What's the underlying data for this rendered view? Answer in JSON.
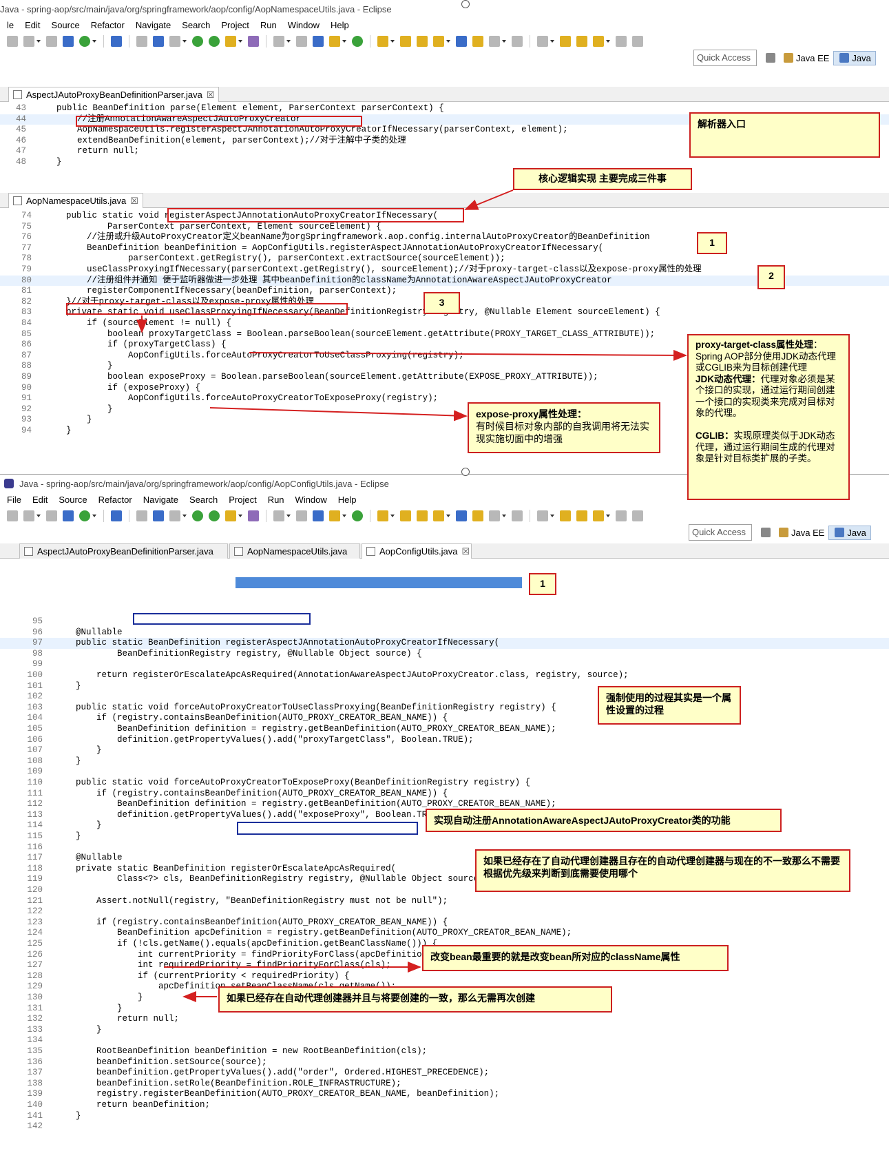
{
  "window_top": {
    "title": "Java - spring-aop/src/main/java/org/springframework/aop/config/AopNamespaceUtils.java - Eclipse",
    "menu": [
      "le",
      "Edit",
      "Source",
      "Refactor",
      "Navigate",
      "Search",
      "Project",
      "Run",
      "Window",
      "Help"
    ],
    "quick_access": "Quick Access",
    "perspectives": [
      "Java EE",
      "Java"
    ],
    "editor1": {
      "tab": "AspectJAutoProxyBeanDefinitionParser.java",
      "lines": [
        {
          "n": "43",
          "t": "    public BeanDefinition parse(Element element, ParserContext parserContext) {"
        },
        {
          "n": "44",
          "t": "        //注册AnnotationAwareAspectJAutoProxyCreator"
        },
        {
          "n": "45",
          "t": "        AopNamespaceUtils.registerAspectJAnnotationAutoProxyCreatorIfNecessary(parserContext, element);"
        },
        {
          "n": "46",
          "t": "        extendBeanDefinition(element, parserContext);//对于注解中子类的处理"
        },
        {
          "n": "47",
          "t": "        return null;"
        },
        {
          "n": "48",
          "t": "    }"
        }
      ]
    },
    "editor2": {
      "tab": "AopNamespaceUtils.java",
      "lines": [
        {
          "n": "74",
          "t": "    public static void registerAspectJAnnotationAutoProxyCreatorIfNecessary("
        },
        {
          "n": "75",
          "t": "            ParserContext parserContext, Element sourceElement) {"
        },
        {
          "n": "76",
          "t": "        //注册或升级AutoProxyCreator定义beanName为orgSpringframework.aop.config.internalAutoProxyCreator的BeanDefinition"
        },
        {
          "n": "77",
          "t": "        BeanDefinition beanDefinition = AopConfigUtils.registerAspectJAnnotationAutoProxyCreatorIfNecessary("
        },
        {
          "n": "78",
          "t": "                parserContext.getRegistry(), parserContext.extractSource(sourceElement));"
        },
        {
          "n": "79",
          "t": "        useClassProxyingIfNecessary(parserContext.getRegistry(), sourceElement);//对于proxy-target-class以及expose-proxy属性的处理"
        },
        {
          "n": "80",
          "t": "        //注册组件并通知 便于监听器做进一步处理 其中beanDefinition的className为AnnotationAwareAspectJAutoProxyCreator"
        },
        {
          "n": "81",
          "t": "        registerComponentIfNecessary(beanDefinition, parserContext);"
        },
        {
          "n": "82",
          "t": "    }//对于proxy-target-class以及expose-proxy属性的处理"
        },
        {
          "n": "83",
          "t": "    private static void useClassProxyingIfNecessary(BeanDefinitionRegistry registry, @Nullable Element sourceElement) {"
        },
        {
          "n": "84",
          "t": "        if (sourceElement != null) {"
        },
        {
          "n": "85",
          "t": "            boolean proxyTargetClass = Boolean.parseBoolean(sourceElement.getAttribute(PROXY_TARGET_CLASS_ATTRIBUTE));"
        },
        {
          "n": "86",
          "t": "            if (proxyTargetClass) {"
        },
        {
          "n": "87",
          "t": "                AopConfigUtils.forceAutoProxyCreatorToUseClassProxying(registry);"
        },
        {
          "n": "88",
          "t": "            }"
        },
        {
          "n": "89",
          "t": "            boolean exposeProxy = Boolean.parseBoolean(sourceElement.getAttribute(EXPOSE_PROXY_ATTRIBUTE));"
        },
        {
          "n": "90",
          "t": "            if (exposeProxy) {"
        },
        {
          "n": "91",
          "t": "                AopConfigUtils.forceAutoProxyCreatorToExposeProxy(registry);"
        },
        {
          "n": "92",
          "t": "            }"
        },
        {
          "n": "93",
          "t": "        }"
        },
        {
          "n": "94",
          "t": "    }"
        }
      ]
    }
  },
  "window_bottom": {
    "title": "Java - spring-aop/src/main/java/org/springframework/aop/config/AopConfigUtils.java - Eclipse",
    "menu": [
      "File",
      "Edit",
      "Source",
      "Refactor",
      "Navigate",
      "Search",
      "Project",
      "Run",
      "Window",
      "Help"
    ],
    "quick_access": "Quick Access",
    "perspectives": [
      "Java EE",
      "Java"
    ],
    "tabs": [
      "AspectJAutoProxyBeanDefinitionParser.java",
      "AopNamespaceUtils.java",
      "AopConfigUtils.java"
    ],
    "lines": [
      {
        "n": "95",
        "t": ""
      },
      {
        "n": "96",
        "t": "    @Nullable"
      },
      {
        "n": "97",
        "t": "    public static BeanDefinition registerAspectJAnnotationAutoProxyCreatorIfNecessary("
      },
      {
        "n": "98",
        "t": "            BeanDefinitionRegistry registry, @Nullable Object source) {"
      },
      {
        "n": "99",
        "t": ""
      },
      {
        "n": "100",
        "t": "        return registerOrEscalateApcAsRequired(AnnotationAwareAspectJAutoProxyCreator.class, registry, source);"
      },
      {
        "n": "101",
        "t": "    }"
      },
      {
        "n": "102",
        "t": ""
      },
      {
        "n": "103",
        "t": "    public static void forceAutoProxyCreatorToUseClassProxying(BeanDefinitionRegistry registry) {"
      },
      {
        "n": "104",
        "t": "        if (registry.containsBeanDefinition(AUTO_PROXY_CREATOR_BEAN_NAME)) {"
      },
      {
        "n": "105",
        "t": "            BeanDefinition definition = registry.getBeanDefinition(AUTO_PROXY_CREATOR_BEAN_NAME);"
      },
      {
        "n": "106",
        "t": "            definition.getPropertyValues().add(\"proxyTargetClass\", Boolean.TRUE);"
      },
      {
        "n": "107",
        "t": "        }"
      },
      {
        "n": "108",
        "t": "    }"
      },
      {
        "n": "109",
        "t": ""
      },
      {
        "n": "110",
        "t": "    public static void forceAutoProxyCreatorToExposeProxy(BeanDefinitionRegistry registry) {"
      },
      {
        "n": "111",
        "t": "        if (registry.containsBeanDefinition(AUTO_PROXY_CREATOR_BEAN_NAME)) {"
      },
      {
        "n": "112",
        "t": "            BeanDefinition definition = registry.getBeanDefinition(AUTO_PROXY_CREATOR_BEAN_NAME);"
      },
      {
        "n": "113",
        "t": "            definition.getPropertyValues().add(\"exposeProxy\", Boolean.TRUE);"
      },
      {
        "n": "114",
        "t": "        }"
      },
      {
        "n": "115",
        "t": "    }"
      },
      {
        "n": "116",
        "t": ""
      },
      {
        "n": "117",
        "t": "    @Nullable"
      },
      {
        "n": "118",
        "t": "    private static BeanDefinition registerOrEscalateApcAsRequired("
      },
      {
        "n": "119",
        "t": "            Class<?> cls, BeanDefinitionRegistry registry, @Nullable Object source) {"
      },
      {
        "n": "120",
        "t": ""
      },
      {
        "n": "121",
        "t": "        Assert.notNull(registry, \"BeanDefinitionRegistry must not be null\");"
      },
      {
        "n": "122",
        "t": ""
      },
      {
        "n": "123",
        "t": "        if (registry.containsBeanDefinition(AUTO_PROXY_CREATOR_BEAN_NAME)) {"
      },
      {
        "n": "124",
        "t": "            BeanDefinition apcDefinition = registry.getBeanDefinition(AUTO_PROXY_CREATOR_BEAN_NAME);"
      },
      {
        "n": "125",
        "t": "            if (!cls.getName().equals(apcDefinition.getBeanClassName())) {"
      },
      {
        "n": "126",
        "t": "                int currentPriority = findPriorityForClass(apcDefinition.getBeanClassName());"
      },
      {
        "n": "127",
        "t": "                int requiredPriority = findPriorityForClass(cls);"
      },
      {
        "n": "128",
        "t": "                if (currentPriority < requiredPriority) {"
      },
      {
        "n": "129",
        "t": "                    apcDefinition.setBeanClassName(cls.getName());"
      },
      {
        "n": "130",
        "t": "                }"
      },
      {
        "n": "131",
        "t": "            }"
      },
      {
        "n": "132",
        "t": "            return null;"
      },
      {
        "n": "133",
        "t": "        }"
      },
      {
        "n": "134",
        "t": ""
      },
      {
        "n": "135",
        "t": "        RootBeanDefinition beanDefinition = new RootBeanDefinition(cls);"
      },
      {
        "n": "136",
        "t": "        beanDefinition.setSource(source);"
      },
      {
        "n": "137",
        "t": "        beanDefinition.getPropertyValues().add(\"order\", Ordered.HIGHEST_PRECEDENCE);"
      },
      {
        "n": "138",
        "t": "        beanDefinition.setRole(BeanDefinition.ROLE_INFRASTRUCTURE);"
      },
      {
        "n": "139",
        "t": "        registry.registerBeanDefinition(AUTO_PROXY_CREATOR_BEAN_NAME, beanDefinition);"
      },
      {
        "n": "140",
        "t": "        return beanDefinition;"
      },
      {
        "n": "141",
        "t": "    }"
      },
      {
        "n": "142",
        "t": ""
      }
    ]
  },
  "notes": {
    "parser_entry": "解析器入口",
    "core_logic": "核心逻辑实现 主要完成三件事",
    "one": "1",
    "two": "2",
    "three": "3",
    "proxy_title": "proxy-target-class属性处理",
    "proxy_body1": "：Spring AOP部分使用JDK动态代理或CGLIB来为目标创建代理",
    "jdk_title": "JDK动态代理：",
    "jdk_body": "代理对象必须是某个接口的实现，通过运行期间创建一个接口的实现类来完成对目标对象的代理。",
    "cglib_title": "CGLIB：",
    "cglib_body": "实现原理类似于JDK动态代理，通过运行期间生成的代理对象是针对目标类扩展的子类。",
    "expose_title": "expose-proxy属性处理：",
    "expose_body": "有时候目标对象内部的自我调用将无法实现实施切面中的增强",
    "one_b": "1",
    "force_note": "强制使用的过程其实是一个属性设置的过程",
    "auto_register": "实现自动注册AnnotationAwareAspectJAutoProxyCreator类的功能",
    "priority_note": "如果已经存在了自动代理创建器且存在的自动代理创建器与现在的不一致那么不需要根据优先级来判断到底需要使用哪个",
    "change_bean": "改变bean最重要的就是改变bean所对应的className属性",
    "no_recreate": "如果已经存在自动代理创建器并且与将要创建的一致，那么无需再次创建"
  },
  "colors": {
    "note_bg": "#ffffc8",
    "note_border": "#cc2020",
    "blue_box": "#1a2e9a",
    "selection": "#2f76d2"
  }
}
